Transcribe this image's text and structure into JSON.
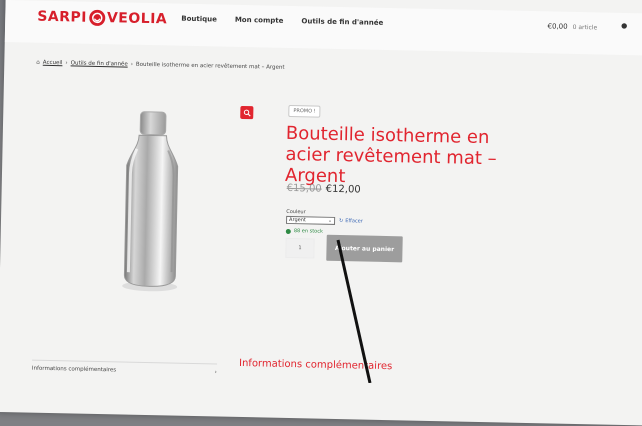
{
  "header": {
    "brand_left": "SARPI",
    "brand_right": "VEOLIA",
    "nav": [
      "Boutique",
      "Mon compte",
      "Outils de fin d'année"
    ],
    "cart_total": "€0,00",
    "cart_count": "0 article"
  },
  "breadcrumb": {
    "home": "Accueil",
    "category": "Outils de fin d'année",
    "current": "Bouteille isotherme en acier revêtement mat – Argent"
  },
  "product": {
    "badge": "PROMO !",
    "title": "Bouteille isotherme en acier revêtement mat – Argent",
    "old_price": "€15,00",
    "price": "€12,00",
    "variation_label": "Couleur",
    "selected_variation": "Argent",
    "clear_label": "Effacer",
    "stock": "88 en stock",
    "quantity": "1",
    "add_to_cart": "Ajouter au panier"
  },
  "footer": {
    "left_tab": "Informations complémentaires",
    "right_heading": "Informations complémentaires"
  },
  "colors": {
    "brand": "#e1252f",
    "stock": "#2e8a44",
    "link": "#3b67b5"
  }
}
